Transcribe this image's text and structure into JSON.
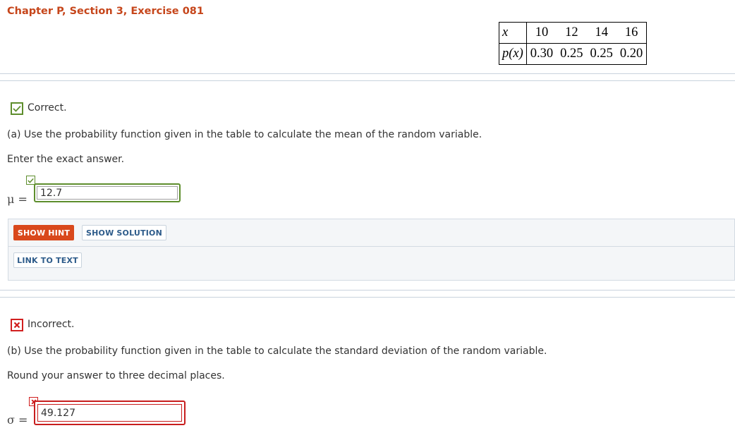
{
  "header": {
    "title": "Chapter P, Section 3, Exercise 081"
  },
  "prob_table": {
    "x_label": "x",
    "px_label": "p(x)",
    "x_values": [
      "10",
      "12",
      "14",
      "16"
    ],
    "p_values": [
      "0.30",
      "0.25",
      "0.25",
      "0.20"
    ]
  },
  "part_a": {
    "status": "Correct.",
    "question": "(a) Use the probability function given in the table to calculate the mean of the random variable.",
    "instruction": "Enter the exact answer.",
    "symbol": "μ =",
    "answer": "12.7"
  },
  "buttons": {
    "hint": "SHOW HINT",
    "solution": "SHOW SOLUTION",
    "link": "LINK TO TEXT"
  },
  "part_b": {
    "status": "Incorrect.",
    "question": "(b) Use the probability function given in the table to calculate the standard deviation of the random variable.",
    "instruction": "Round your answer to three decimal places.",
    "symbol": "σ =",
    "answer": "49.127"
  },
  "colors": {
    "title": "#c6461b",
    "correct": "#5e8e2d",
    "incorrect": "#d11f1f",
    "hint_button": "#d9481b",
    "link_text": "#2d5b8a"
  }
}
